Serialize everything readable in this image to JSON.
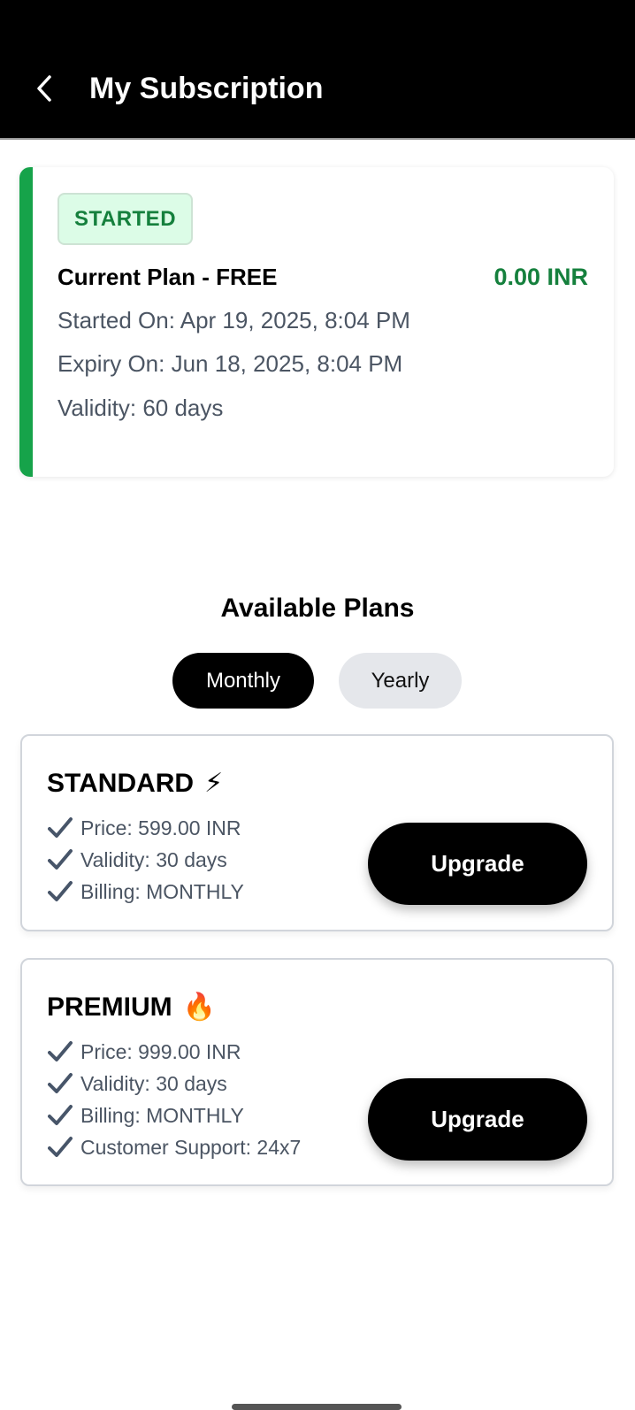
{
  "header": {
    "title": "My Subscription"
  },
  "current_plan": {
    "status": "STARTED",
    "name": "Current Plan - FREE",
    "price": "0.00 INR",
    "started_on": "Started On: Apr 19, 2025, 8:04 PM",
    "expiry_on": "Expiry On: Jun 18, 2025, 8:04 PM",
    "validity": "Validity: 60 days"
  },
  "available_plans": {
    "title": "Available Plans",
    "tabs": [
      {
        "label": "Monthly",
        "active": true
      },
      {
        "label": "Yearly",
        "active": false
      }
    ],
    "plans": [
      {
        "name": "STANDARD",
        "emoji": "⚡",
        "features": [
          "Price: 599.00 INR",
          "Validity: 30 days",
          "Billing: MONTHLY"
        ],
        "button_label": "Upgrade"
      },
      {
        "name": "PREMIUM",
        "emoji": "🔥",
        "features": [
          "Price: 999.00 INR",
          "Validity: 30 days",
          "Billing: MONTHLY",
          "Customer Support: 24x7"
        ],
        "button_label": "Upgrade"
      }
    ]
  },
  "colors": {
    "accent_green": "#16a34a",
    "badge_bg": "#dcfce7",
    "price_green": "#15803d",
    "primary": "#000000"
  }
}
